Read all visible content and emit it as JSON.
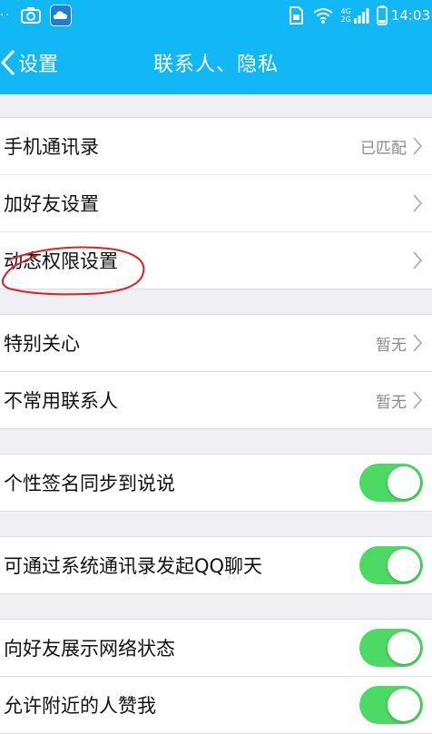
{
  "status_bar": {
    "dots": "··",
    "time": "14:03",
    "network_top": "4G",
    "network_bottom": "2G",
    "icons": [
      "camera-icon",
      "app-icon",
      "sim-icon",
      "wifi-icon",
      "signal-icon",
      "battery-icon"
    ]
  },
  "nav": {
    "back_label": "设置",
    "title": "联系人、隐私"
  },
  "groups": [
    {
      "rows": [
        {
          "label": "手机通讯录",
          "value": "已匹配",
          "control": "chevron"
        },
        {
          "label": "加好友设置",
          "value": "",
          "control": "chevron"
        },
        {
          "label": "动态权限设置",
          "value": "",
          "control": "chevron"
        }
      ]
    },
    {
      "rows": [
        {
          "label": "特别关心",
          "value": "暂无",
          "control": "chevron"
        },
        {
          "label": "不常用联系人",
          "value": "暂无",
          "control": "chevron"
        }
      ]
    },
    {
      "rows": [
        {
          "label": "个性签名同步到说说",
          "control": "toggle",
          "on": true
        }
      ]
    },
    {
      "rows": [
        {
          "label": "可通过系统通讯录发起QQ聊天",
          "control": "toggle",
          "on": true
        }
      ]
    },
    {
      "rows": [
        {
          "label": "向好友展示网络状态",
          "control": "toggle",
          "on": true
        },
        {
          "label": "允许附近的人赞我",
          "control": "toggle",
          "on": true
        }
      ]
    }
  ],
  "colors": {
    "accent": "#12b7f5",
    "toggle_on": "#4cd964",
    "annotation": "#d9232a"
  }
}
